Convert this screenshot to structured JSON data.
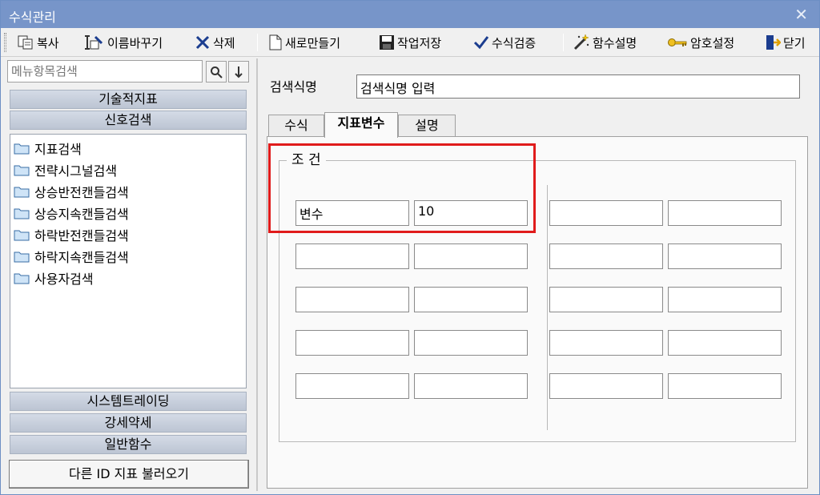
{
  "window": {
    "title": "수식관리"
  },
  "toolbar": {
    "copy": "복사",
    "rename": "이름바꾸기",
    "delete": "삭제",
    "new": "새로만들기",
    "save": "작업저장",
    "verify": "수식검증",
    "help": "함수설명",
    "password": "암호설정",
    "close": "닫기"
  },
  "sidebar": {
    "search_placeholder": "메뉴항목검색",
    "categories_top": [
      "기술적지표",
      "신호검색"
    ],
    "items": [
      "지표검색",
      "전략시그널검색",
      "상승반전캔들검색",
      "상승지속캔들검색",
      "하락반전캔들검색",
      "하락지속캔들검색",
      "사용자검색"
    ],
    "categories_bottom": [
      "시스템트레이딩",
      "강세약세",
      "일반함수"
    ],
    "load_button": "다른 ID 지표 불러오기"
  },
  "editor": {
    "name_label": "검색식명",
    "name_value": "검색식명 입력",
    "tabs": [
      "수식",
      "지표변수",
      "설명"
    ],
    "active_tab": "지표변수",
    "group_title": "조 건",
    "variable_name": "변수",
    "variable_value": "10"
  },
  "colors": {
    "titlebar": "#7795c9",
    "highlight": "#e01b1b",
    "category": "#c8d0dc"
  }
}
